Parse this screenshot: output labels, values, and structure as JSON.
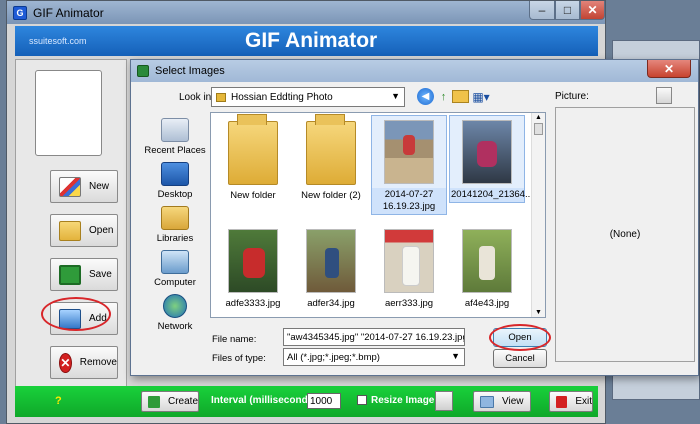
{
  "main_window": {
    "title": "GIF Animator",
    "banner_site": "ssuitesoft.com",
    "banner_title": "GIF Animator",
    "controls": {
      "minimize": "–",
      "maximize": "□",
      "close": "✕"
    }
  },
  "sidebar": {
    "buttons": [
      {
        "label": "New",
        "icon": "new-image-icon"
      },
      {
        "label": "Open",
        "icon": "folder-open-icon"
      },
      {
        "label": "Save",
        "icon": "floppy-save-icon"
      },
      {
        "label": "Add",
        "icon": "add-image-icon"
      },
      {
        "label": "Remove",
        "icon": "remove-x-icon"
      }
    ]
  },
  "bottom_bar": {
    "help": "?",
    "create_label": "Create",
    "interval_label": "Interval (milliseconds)",
    "interval_value": "1000",
    "resize_label": "Resize Image",
    "resize_checked": false,
    "view_label": "View",
    "exit_label": "Exit"
  },
  "dialog": {
    "title": "Select Images",
    "close": "✕",
    "lookin_label": "Look in:",
    "lookin_value": "Hossian Eddting Photo",
    "places": [
      "Recent Places",
      "Desktop",
      "Libraries",
      "Computer",
      "Network"
    ],
    "files": [
      {
        "name": "New folder",
        "type": "folder",
        "selected": false
      },
      {
        "name": "New folder (2)",
        "type": "folder",
        "selected": false
      },
      {
        "name": "2014-07-27 16.19.23.jpg",
        "type": "photo",
        "selected": true
      },
      {
        "name": "20141204_21364...",
        "type": "photo",
        "selected": true
      },
      {
        "name": "adfe3333.jpg",
        "type": "photo",
        "selected": false
      },
      {
        "name": "adfer34.jpg",
        "type": "photo",
        "selected": false
      },
      {
        "name": "aerr333.jpg",
        "type": "photo",
        "selected": false
      },
      {
        "name": "af4e43.jpg",
        "type": "photo",
        "selected": false
      }
    ],
    "file_name_label": "File name:",
    "file_name_value": "\"aw4345345.jpg\" \"2014-07-27 16.19.23.jpg\" \"2",
    "file_type_label": "Files of type:",
    "file_type_value": "All (*.jpg;*.jpeg;*.bmp)",
    "open_label": "Open",
    "cancel_label": "Cancel",
    "picture_label": "Picture:",
    "picture_preview": "(None)"
  }
}
